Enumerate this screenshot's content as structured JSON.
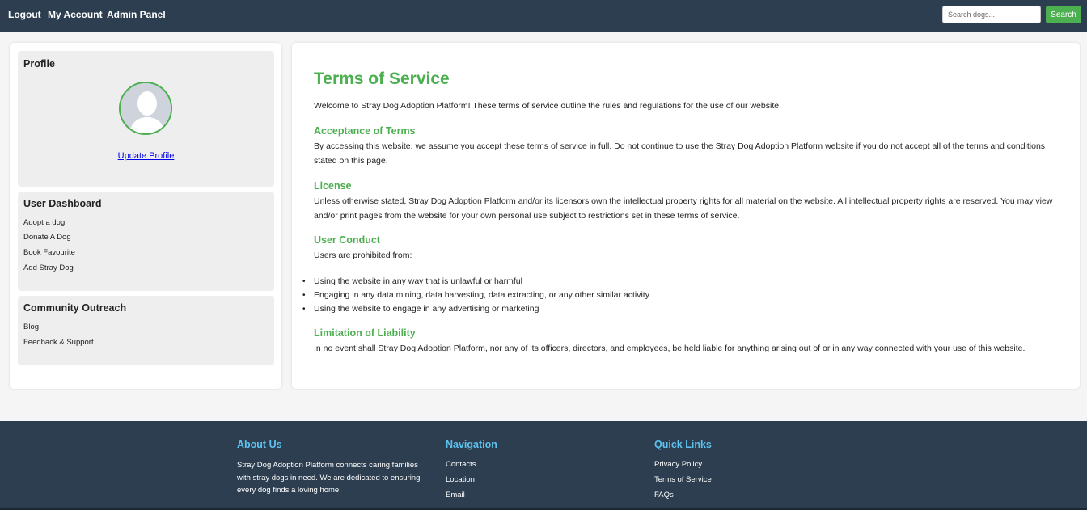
{
  "nav": {
    "links": [
      "Logout",
      "My Account",
      "Admin Panel"
    ],
    "search_placeholder": "Search dogs...",
    "search_button": "Search"
  },
  "sidebar": {
    "profile": {
      "title": "Profile",
      "update_link": "Update Profile"
    },
    "dashboard": {
      "title": "User Dashboard",
      "items": [
        "Adopt a dog",
        "Donate A Dog",
        "Book Favourite",
        "Add Stray Dog"
      ]
    },
    "community": {
      "title": "Community Outreach",
      "items": [
        "Blog",
        "Feedback & Support"
      ]
    }
  },
  "main": {
    "title": "Terms of Service",
    "intro": "Welcome to Stray Dog Adoption Platform! These terms of service outline the rules and regulations for the use of our website.",
    "sections": [
      {
        "heading": "Acceptance of Terms",
        "text": "By accessing this website, we assume you accept these terms of service in full. Do not continue to use the Stray Dog Adoption Platform website if you do not accept all of the terms and conditions stated on this page."
      },
      {
        "heading": "License",
        "text": "Unless otherwise stated, Stray Dog Adoption Platform and/or its licensors own the intellectual property rights for all material on the website. All intellectual property rights are reserved. You may view and/or print pages from the website for your own personal use subject to restrictions set in these terms of service."
      },
      {
        "heading": "User Conduct",
        "text": "Users are prohibited from:",
        "list": [
          "Using the website in any way that is unlawful or harmful",
          "Engaging in any data mining, data harvesting, data extracting, or any other similar activity",
          "Using the website to engage in any advertising or marketing"
        ]
      },
      {
        "heading": "Limitation of Liability",
        "text": "In no event shall Stray Dog Adoption Platform, nor any of its officers, directors, and employees, be held liable for anything arising out of or in any way connected with your use of this website."
      }
    ]
  },
  "footer": {
    "about": {
      "title": "About Us",
      "text": "Stray Dog Adoption Platform connects caring families with stray dogs in need. We are dedicated to ensuring every dog finds a loving home."
    },
    "navigation": {
      "title": "Navigation",
      "items": [
        "Contacts",
        "Location",
        "Email"
      ]
    },
    "quick_links": {
      "title": "Quick Links",
      "items": [
        "Privacy Policy",
        "Terms of Service",
        "FAQs"
      ]
    }
  },
  "colors": {
    "nav_bg": "#2c3e50",
    "accent": "#4caf50",
    "footer_heading": "#5ec2ef"
  },
  "icons": {
    "avatar": "default-user-silhouette"
  }
}
